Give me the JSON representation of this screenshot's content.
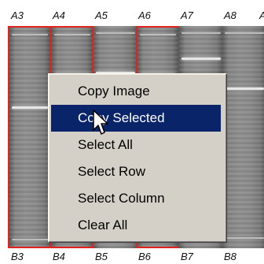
{
  "lanes": {
    "top_labels": [
      "A3",
      "A4",
      "A5",
      "A6",
      "A7",
      "A8",
      "A"
    ],
    "bottom_labels": [
      "B3",
      "B4",
      "B5",
      "B6",
      "B7",
      "B8"
    ],
    "selected_lanes": [
      "A3",
      "A4",
      "A6"
    ],
    "selection_color": "#e0231c"
  },
  "context_menu": {
    "items": [
      {
        "label": "Copy Image"
      },
      {
        "label": "Copy Selected",
        "highlighted": true
      },
      {
        "label": "Select All"
      },
      {
        "label": "Select Row"
      },
      {
        "label": "Select Column"
      },
      {
        "label": "Clear All"
      }
    ],
    "highlight_color": "#0a246a"
  },
  "cursor": {
    "icon": "arrow-pointer-icon"
  }
}
